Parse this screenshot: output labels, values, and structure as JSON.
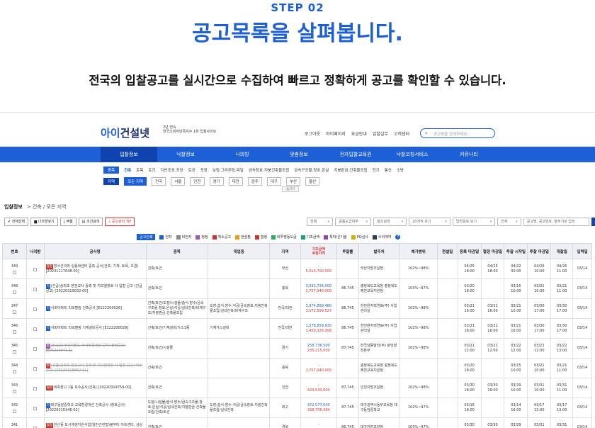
{
  "step": "STEP 02",
  "headline": "공고목록을 살펴봅니다.",
  "subline": "전국의 입찰공고를 실시간으로 수집하여 빠르고 정확하게 공고를 확인할 수 있습니다.",
  "colors": {
    "brand": "#1d5fd6",
    "brand_dark": "#0f44b0",
    "red": "#d33333"
  },
  "site": {
    "logo_a": "아이",
    "logo_b": "건설넷",
    "logo_sub1": "2년 연속",
    "logo_sub2": "한국소비자만족지수 1위 입찰사이트",
    "top_links": [
      "로그아웃",
      "마이페이지",
      "요금안내",
      "입찰실무",
      "고객센터"
    ],
    "search_placeholder": "공고명을 검색하세요.",
    "gnb": [
      "입찰정보",
      "낙찰정보",
      "나의방",
      "맞춤정보",
      "전자입찰교육원",
      "낙찰코칭서비스",
      "커뮤니티"
    ],
    "row1": {
      "label": "종목",
      "items": [
        "건축",
        "토목",
        "토건",
        "지반조성.포장",
        "토공",
        "포장",
        "보링.그라우팅.파일",
        "금속창호.지붕건축물조립",
        "금속구조물.창호.온실",
        "지붕판금.건축물조립",
        "전기",
        "통신",
        "소방"
      ]
    },
    "row2": {
      "label": "지역",
      "items": [
        "모든 지역",
        "전국",
        "서울",
        "인천",
        "경기",
        "대전",
        "광주",
        "대구",
        "부산",
        "울산"
      ]
    },
    "more": "숨기기"
  },
  "crumb": {
    "title": "입찰정보",
    "path": "건축 / 모든 지역"
  },
  "toolbar": [
    "전체선택",
    "나의방넣기",
    "엑셀",
    "조건검색",
    "공고관리 TIP"
  ],
  "filters": [
    "전체",
    "공동도급여부",
    "참조검색",
    "20개씩 보기",
    "입력일로 보기",
    "전체",
    "공고명, 공고번호, 발주기관 입력"
  ],
  "filter_btn": "검색",
  "legend": {
    "selected": "공고인쇄",
    "items": [
      {
        "label": "전자",
        "color": "#1d5fd6"
      },
      {
        "label": "비전자",
        "color": "#888888"
      },
      {
        "label": "정정",
        "color": "#9b59b6"
      },
      {
        "label": "취소공고",
        "color": "#d33333"
      },
      {
        "label": "현설필",
        "color": "#f39c12"
      },
      {
        "label": "협정",
        "color": "#c0392b"
      },
      {
        "label": "비투명동도급",
        "color": "#27ae60"
      },
      {
        "label": "기초금액",
        "color": "#16a085"
      },
      {
        "label": "특허/신기술",
        "color": "#8e44ad"
      },
      {
        "label": "PQ심사",
        "color": "#d4ac0d"
      },
      {
        "label": "수의계약",
        "color": "#2c3e50"
      }
    ]
  },
  "headers": [
    "번호",
    "나의방",
    "공사명",
    "종목",
    "대업종",
    "지역",
    "기초금액",
    "추정가격",
    "투찰률",
    "발주처",
    "예가범위",
    "현설일",
    "등록 마감일",
    "협정 마감일",
    "투찰 시작일",
    "투찰 마감일",
    "개찰일",
    "입력일"
  ],
  "rows": [
    {
      "no": "349",
      "tag": "협정",
      "tagc": "#c0392b",
      "title": "방사선의학 실용화센터 증축 공사(건축, 기계, 토목, 조경) [20231117648-00]",
      "kind": "건축/토건",
      "major": "",
      "region": "부산",
      "base": "-",
      "est": "5,010,700,000",
      "rate": "",
      "org": "부산지방조달청",
      "range": "102%~98%",
      "site": "",
      "reg": "04/25 18:00",
      "agr": "04/25 18:00",
      "bstart": "04/22 00:00",
      "bend": "04/26 10:00",
      "open": "04/26 11:00",
      "input": "03/14"
    },
    {
      "no": "348",
      "tag": "기",
      "tagc": "#1d5fd6",
      "title": "(긴급)송학초 본관교사 증축 및 지보열창호 사 입찰 공고 (긴급공고) [20220319032-00]",
      "kind": "건축/토건",
      "major": "",
      "region": "충북",
      "base": "3,033,734,000",
      "est": "2,757,940,000",
      "rate": "86.745",
      "org": "충청북도교육청 충청북도제천교육지원청",
      "range": "103%~97%",
      "site": "",
      "reg": "03/20 18:00",
      "agr": "",
      "bstart": "03/15 10:00",
      "bend": "03/21 10:00",
      "open": "03/21 11:00",
      "input": "03/14"
    },
    {
      "no": "347",
      "tag": "기",
      "tagc": "#1d5fd6",
      "title": "사회아파트 리모델링 건축공사 [E122200026]",
      "kind": "건축/토건/도장/시설물/습식.방수/금속구조물.창호.온실/석공/실내건축/비계구조/지붕판금.건축물조립",
      "major": "도장.습식.방수.석공/금속창호.지붕건축물조립/실내건축/비계구조",
      "region": "전국/대전",
      "base": "3,974,859,480",
      "est": "3,572,599,527",
      "rate": "86.745",
      "org": "한전원자력연료(주) 사업관리실",
      "range": "102%~98%",
      "site": "",
      "reg": "03/21 16:00",
      "agr": "03/21 16:00",
      "bstart": "03/21 10:00",
      "bend": "03/30 17:00",
      "open": "03/30 17:00",
      "input": "03/14"
    },
    {
      "no": "346",
      "tag": "기",
      "tagc": "#1d5fd6",
      "title": "사회아파트 리모델링 기계설비공사 [E122200029]",
      "kind": "건축/토건/기계설비/가스1종",
      "major": "기계가스설비",
      "region": "전국/대전",
      "base": "1,578,859,930",
      "est": "1,450,326,308",
      "rate": "86.745",
      "org": "한전원자력연료(주) 사업관리실",
      "range": "102%~98%",
      "site": "",
      "reg": "03/21 16:00",
      "agr": "03/21 16:00",
      "bstart": "03/21 16:00",
      "bend": "03/30 17:00",
      "open": "03/30 17:00",
      "input": "03/14"
    },
    {
      "no": "345",
      "tag": "정",
      "tagc": "#9b59b6",
      "title": "2022년 주간지방도 주거환경개선 공사 (정정공고) [E06220041-1]",
      "kind": "건축/토건/시설물",
      "major": "",
      "region": "경기",
      "base": "258,736,500",
      "est": "235,215,000",
      "rate": "87.745",
      "org": "한국남동발전(주) 분당발전본부",
      "range": "102%~98%",
      "site": "",
      "reg": "03/21 12:00",
      "agr": "03/21 12:00",
      "bstart": "03/22 12:00",
      "bend": "03/22 12:00",
      "open": "03/22 13:00",
      "input": "03/14",
      "strike": true
    },
    {
      "no": "344",
      "tag": "취",
      "tagc": "#d33333",
      "title": "(긴급)송학초 본관교사 증축 및 지보열창호 사 입찰 공고 (취소공고) [20220318862-01]",
      "kind": "건축/토건",
      "major": "",
      "region": "충북",
      "base": "-",
      "est": "2,757,940,000",
      "rate": "",
      "org": "충청북도교육청 충청북도제천교육지원청",
      "range": "",
      "site": "",
      "reg": "03/20 18:00",
      "agr": "",
      "bstart": "03/15 10:00",
      "bend": "03/21 10:00",
      "open": "03/21 11:00",
      "input": "03/14",
      "strike": true
    },
    {
      "no": "343",
      "tag": "협정",
      "tagc": "#c0392b",
      "title": "비축창고 1동 보수공사(건축) [20220319759-00]",
      "kind": "건축/토건",
      "major": "",
      "region": "인천",
      "base": "-",
      "est": "423,530,000",
      "rate": "87.745",
      "org": "인천지방조달청",
      "range": "102%~98%",
      "site": "",
      "reg": "03/30 18:00",
      "agr": "03/30 18:00",
      "bstart": "03/29 10:00",
      "bend": "03/31 10:00",
      "open": "03/31 11:00",
      "input": "03/14"
    },
    {
      "no": "342",
      "tag": "기",
      "tagc": "#1d5fd6",
      "title": "대구동암중학교 교육환경개선 건축공사 (창호공사) [20220315346-02]",
      "kind": "도장/시설물/습식.방수/금속구조물.창호.온실/석공/실내건축/지붕판금.건축물조립/건축/토건",
      "major": "도장.습식.방수.석공/금속창호.지붕건축물조립/실내건축",
      "region": "대구",
      "base": "372,577,000",
      "est": "338,706,364",
      "rate": "87.745",
      "org": "대구광역시동부교육청 대구동암중학교",
      "range": "102%~97%",
      "site": "",
      "reg": "03/16 18:00",
      "agr": "",
      "bstart": "03/14 16:00",
      "bend": "03/17 12:00",
      "open": "03/17 13:00",
      "input": "03/14"
    },
    {
      "no": "341",
      "tag": "협정",
      "tagc": "#c0392b",
      "title": "완산동 도시재생지원사업(일반근린형)불무터 아트센터, 상상창고 조성사업(건축) [20220317526-00]",
      "kind": "건축/토건",
      "major": "",
      "region": "경북",
      "base": "-",
      "est": "3,312,028,182",
      "rate": "86.745",
      "org": "대구지방조달청",
      "range": "103%~97%",
      "site": "",
      "reg": "03/30 18:00",
      "agr": "03/30 18:00",
      "bstart": "03/29 00:00",
      "bend": "03/31 10:00",
      "open": "03/31 11:00",
      "input": "03/14"
    }
  ]
}
